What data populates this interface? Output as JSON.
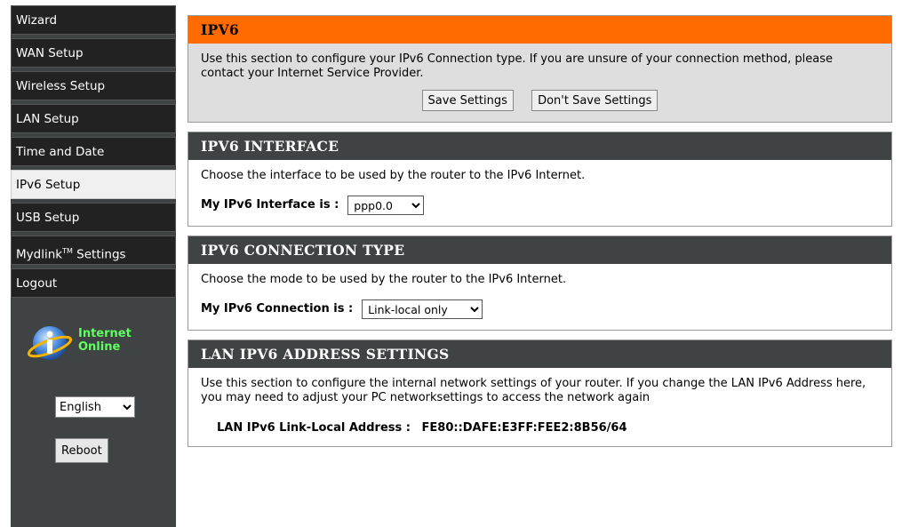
{
  "sidebar": {
    "items": [
      {
        "label": "Wizard"
      },
      {
        "label": "WAN Setup"
      },
      {
        "label": "Wireless Setup"
      },
      {
        "label": "LAN Setup"
      },
      {
        "label": "Time and Date"
      },
      {
        "label": "IPv6 Setup"
      },
      {
        "label": "USB Setup"
      },
      {
        "label": "Mydlink",
        "sup": "TM",
        "suffix": " Settings"
      },
      {
        "label": "Logout"
      }
    ],
    "status": {
      "line1": "Internet",
      "line2": "Online",
      "color": "#5fff5f"
    },
    "language": {
      "selected": "English"
    },
    "reboot_label": "Reboot"
  },
  "ipv6": {
    "title": "IPV6",
    "description": "Use this section to configure your IPv6 Connection type. If you are unsure of your connection method, please contact your Internet Service Provider.",
    "save_label": "Save Settings",
    "dont_save_label": "Don't Save Settings"
  },
  "interface": {
    "title": "IPV6 INTERFACE",
    "description": "Choose the interface to be used by the router to the IPv6 Internet.",
    "field_label": "My IPv6 Interface is :",
    "selected": "ppp0.0"
  },
  "connection": {
    "title": "IPV6 CONNECTION TYPE",
    "description": "Choose the mode to be used by the router to the IPv6 Internet.",
    "field_label": "My IPv6 Connection is :",
    "selected": "Link-local only"
  },
  "lan": {
    "title": "LAN IPV6 ADDRESS SETTINGS",
    "description": "Use this section to configure the internal network settings of your router. If you change the LAN IPv6 Address here, you may need to adjust your PC networksettings to access the network again",
    "address_label": "LAN IPv6 Link-Local Address :",
    "address_value": "FE80::DAFE:E3FF:FEE2:8B56/64"
  },
  "colors": {
    "accent": "#ff6b00",
    "header": "#404343",
    "sidebar": "#404343"
  }
}
